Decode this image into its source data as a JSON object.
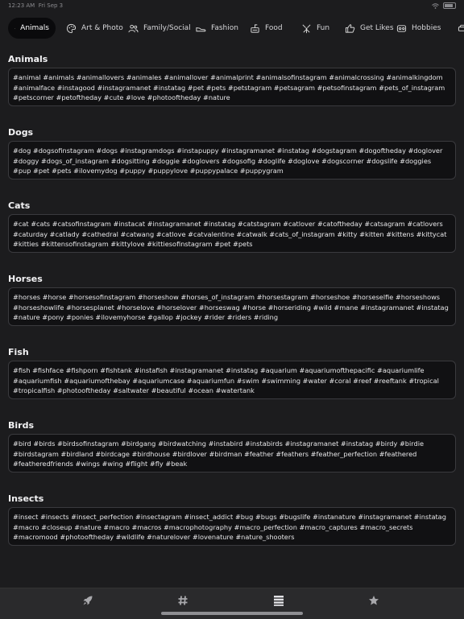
{
  "status_bar": {
    "time": "12:23 AM",
    "date": "Fri Sep 3"
  },
  "tabs": [
    {
      "label": "Animals",
      "icon": "paw-icon"
    },
    {
      "label": "Art & Photo",
      "icon": "palette-icon"
    },
    {
      "label": "Family/Social",
      "icon": "people-icon"
    },
    {
      "label": "Fashion",
      "icon": "shoe-icon"
    },
    {
      "label": "Food",
      "icon": "food-icon"
    },
    {
      "label": "Fun",
      "icon": "fun-icon"
    },
    {
      "label": "Get Likes",
      "icon": "thumbs-up-icon"
    },
    {
      "label": "Hobbies",
      "icon": "hobbies-icon"
    }
  ],
  "sections": [
    {
      "title": "Animals",
      "tags": "#animal #animals #animallovers #animales #animallover #animalprint #animalsofinstagram #animalcrossing #animalkingdom #animalface #instagood #instagramanet #instatag #pet #pets #petstagram #petsagram #petsofinstagram #pets_of_instagram #petscorner #petoftheday #cute #love #photooftheday #nature"
    },
    {
      "title": "Dogs",
      "tags": "#dog #dogsofinstagram #dogs #instagramdogs #instapuppy #instagramanet #instatag #dogstagram #dogoftheday #doglover #doggy #dogs_of_instagram #dogsitting #doggie #doglovers #dogsofig #doglife #doglove #dogscorner #dogslife #doggies #pup #pet #pets #ilovemydog #puppy #puppylove #puppypalace #puppygram"
    },
    {
      "title": "Cats",
      "tags": "#cat #cats #catsofinstagram #instacat #instagramanet #instatag #catstagram #catlover #catoftheday #catsagram #catlovers #caturday #catlady #cathedral #catwang #catlove #catvalentine #catwalk #cats_of_instagram #kitty #kitten #kittens #kittycat #kitties #kittensofinstagram #kittylove #kittiesofinstagram #pet #pets"
    },
    {
      "title": "Horses",
      "tags": "#horses #horse #horsesofinstagram #horseshow #horses_of_instagram #horsestagram #horseshoe #horseselfie #horseshows #horseshowlife #horsesplanet #horselove #horselover #horseswag #horse #horseriding #wild #mane #instagramanet #instatag #nature #pony #ponies #ilovemyhorse #gallop #jockey #rider #riders #riding"
    },
    {
      "title": "Fish",
      "tags": "#fish #fishface #fishporn #fishtank #instafish #instagramanet #instatag #aquarium #aquariumofthepacific #aquariumlife #aquariumfish #aquariumofthebay #aquariumcase #aquariumfun #swim #swimming #water #coral #reef #reeftank #tropical #tropicalfish #photooftheday #saltwater #beautiful #ocean #watertank"
    },
    {
      "title": "Birds",
      "tags": "#bird #birds #birdsofinstagram #birdgang #birdwatching #instabird #instabirds #instagramanet #instatag #birdy #birdie #birdstagram #birdland #birdcage #birdhouse #birdlover #birdman #feather #feathers #feather_perfection #feathered #featheredfriends #wings #wing #flight #fly #beak"
    },
    {
      "title": "Insects",
      "tags": "#insect #insects #insect_perfection #insectagram #insect_addict #bug #bugs #bugslife #instanature #instagramanet #instatag #macro #closeup #nature #macro #macros #macrophotography #macro_perfection #macro_captures #macro_secrets #macromood #photooftheday #wildlife #naturelover #lovenature #nature_shooters"
    }
  ],
  "bottom_bar": [
    "rocket-icon",
    "hashtag-icon",
    "list-icon",
    "star-icon"
  ]
}
